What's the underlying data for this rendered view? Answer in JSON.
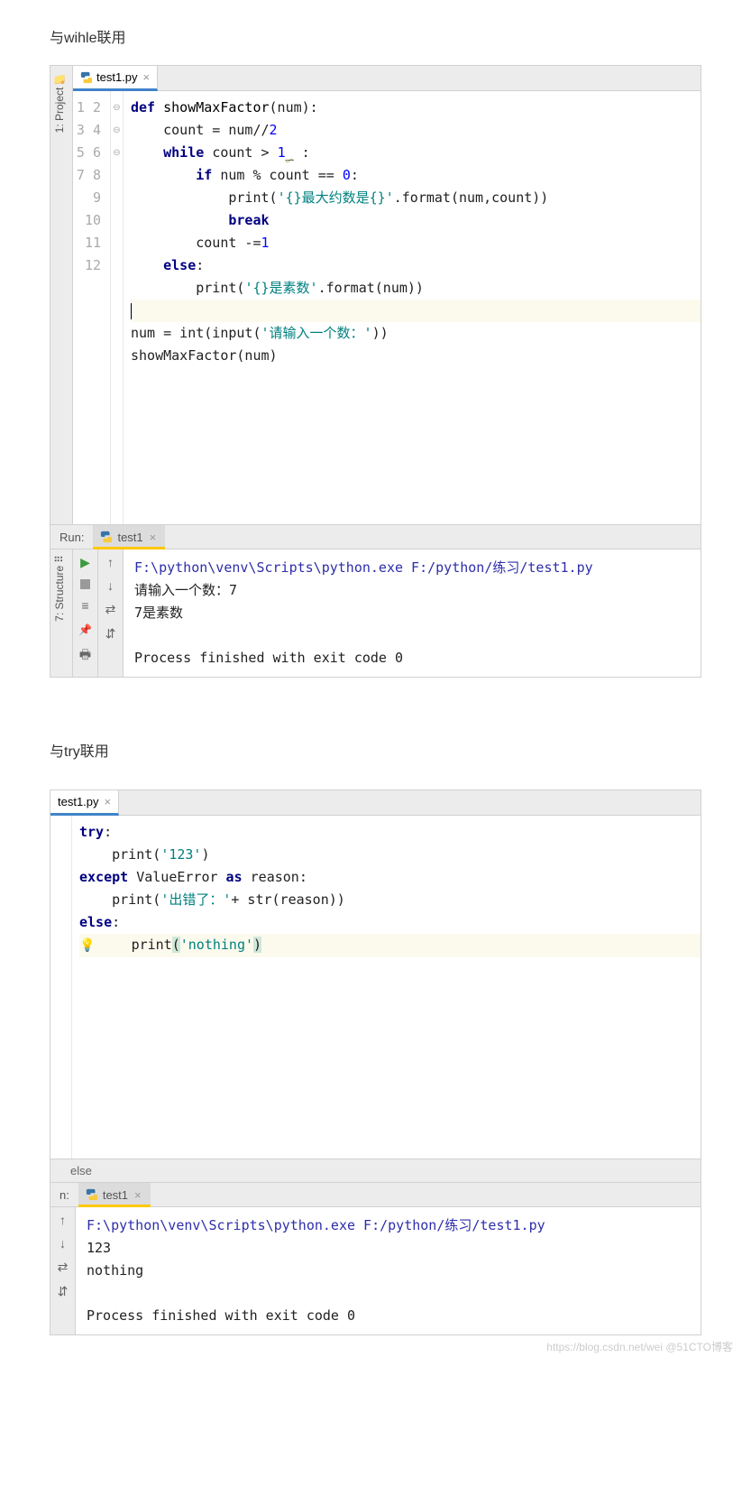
{
  "section1_title": "与wihle联用",
  "section2_title": "与try联用",
  "editor1": {
    "filename": "test1.py",
    "line_numbers": [
      "1",
      "2",
      "3",
      "4",
      "5",
      "6",
      "7",
      "8",
      "9",
      "10",
      "11",
      "12"
    ],
    "fold_marks": [
      "⊖",
      "",
      "",
      "⊖",
      "",
      "",
      "",
      "",
      "⊖",
      "",
      "",
      ""
    ],
    "code": {
      "l1": {
        "kw1": "def ",
        "fn": "showMaxFactor",
        "txt": "(num):"
      },
      "l2": {
        "indent": "    ",
        "txt1": "count = num//",
        "num": "2"
      },
      "l3": {
        "indent": "    ",
        "kw": "while ",
        "txt": "count > ",
        "num": "1",
        "under": "_",
        "post": " :"
      },
      "l4": {
        "indent": "        ",
        "kw": "if ",
        "txt": "num % count == ",
        "num": "0",
        "post": ":"
      },
      "l5": {
        "indent": "            ",
        "fn": "print",
        "open": "(",
        "str": "'{}最大约数是{}'",
        "txt": ".format(num,count))"
      },
      "l6": {
        "indent": "            ",
        "kw": "break"
      },
      "l7": {
        "indent": "        ",
        "txt": "count -=",
        "num": "1"
      },
      "l8": {
        "indent": "    ",
        "kw": "else",
        "post": ":"
      },
      "l9": {
        "indent": "        ",
        "fn": "print",
        "open": "(",
        "str": "'{}是素数'",
        "txt": ".format(num))"
      },
      "l10": {
        "cursor": "|"
      },
      "l11": {
        "txt1": "num = int(input(",
        "str": "'请输入一个数：'",
        "txt2": "))"
      },
      "l12": {
        "txt": "showMaxFactor(num)"
      }
    }
  },
  "run1": {
    "label": "Run:",
    "tab": "test1",
    "path": "F:\\python\\venv\\Scripts\\python.exe F:/python/练习/test1.py",
    "line2": "请输入一个数：7",
    "line3": "7是素数",
    "line4": "",
    "line5": "Process finished with exit code 0"
  },
  "side_project": "1: Project",
  "side_structure": "7: Structure",
  "editor2": {
    "filename": "test1.py",
    "code": {
      "l1": {
        "kw": "try",
        "post": ":"
      },
      "l2": {
        "indent": "    ",
        "fn": "print",
        "open": "(",
        "str": "'123'",
        "close": ")"
      },
      "l3": {
        "kw": "except ",
        "cls": "ValueError",
        "kw2": " as ",
        "txt": "reason:"
      },
      "l4": {
        "indent": "    ",
        "fn": "print",
        "open": "(",
        "str": "'出错了：'",
        "txt": "+ str(reason))"
      },
      "l5": {
        "kw": "else",
        "post": ":"
      },
      "l6": {
        "indent": "    ",
        "fn": "print",
        "open": "(",
        "str": "'nothing'",
        "close": ")"
      }
    },
    "breadcrumb": "else"
  },
  "run2": {
    "label": "n:",
    "tab": "test1",
    "path": "F:\\python\\venv\\Scripts\\python.exe F:/python/练习/test1.py",
    "line2": "123",
    "line3": "nothing",
    "line4": "",
    "line5": "Process finished with exit code 0"
  },
  "watermark": "https://blog.csdn.net/wei @51CTO博客"
}
